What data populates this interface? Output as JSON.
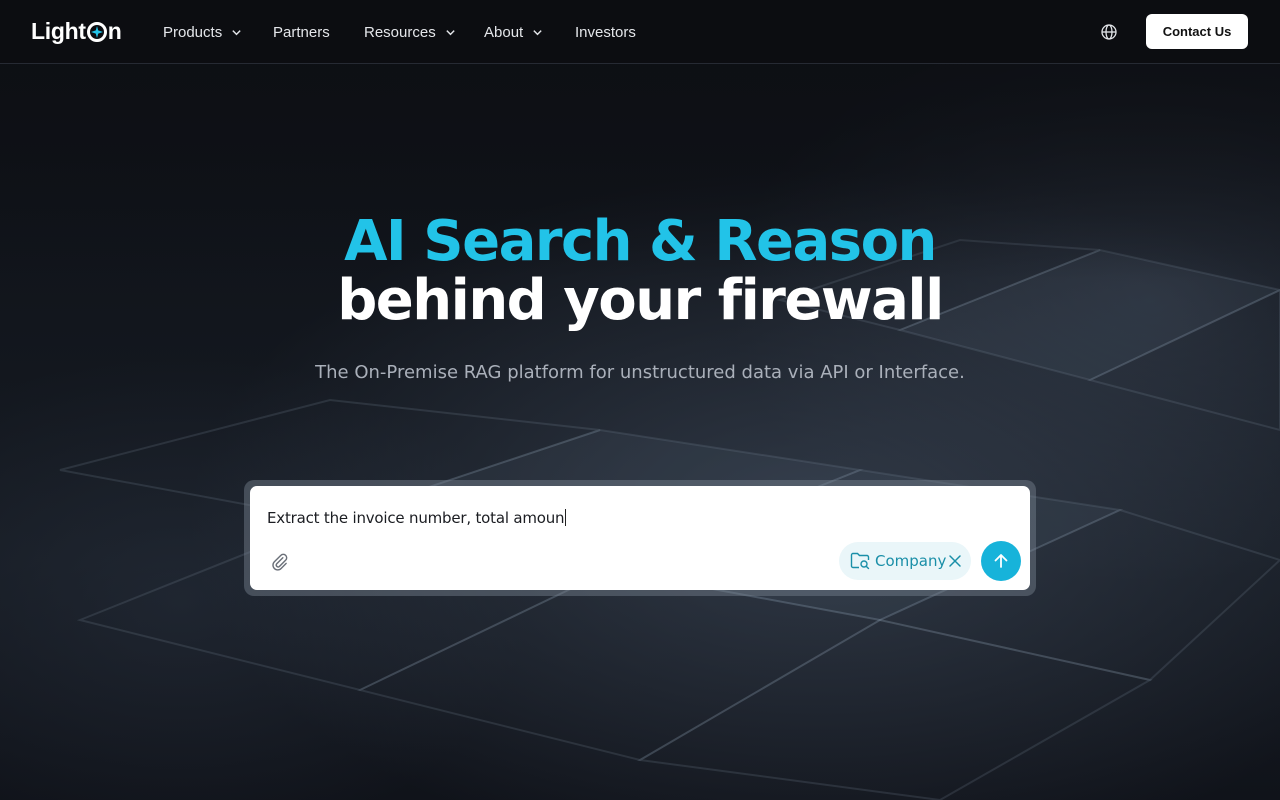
{
  "nav": {
    "logo_text_left": "Light",
    "logo_text_right": "n",
    "items": [
      {
        "label": "Products",
        "has_dropdown": true
      },
      {
        "label": "Partners",
        "has_dropdown": false
      },
      {
        "label": "Resources",
        "has_dropdown": true
      },
      {
        "label": "About",
        "has_dropdown": true
      },
      {
        "label": "Investors",
        "has_dropdown": false
      }
    ],
    "language_icon": "globe-icon",
    "contact_label": "Contact Us"
  },
  "hero": {
    "title_line1": "AI Search & Reason",
    "title_line2": "behind your firewall",
    "subtitle": "The On-Premise RAG platform for unstructured data via API or Interface."
  },
  "search": {
    "value": "Extract the invoice number, total amoun",
    "attach_icon": "paperclip-icon",
    "scope_chip": {
      "label": "Company",
      "icon": "folder-search-icon",
      "remove_icon": "close-icon"
    },
    "send_icon": "arrow-up-icon"
  },
  "colors": {
    "accent": "#22c3e8",
    "send_button": "#17b3da",
    "chip_bg": "#eaf6f9",
    "chip_text": "#1a8fa8"
  }
}
